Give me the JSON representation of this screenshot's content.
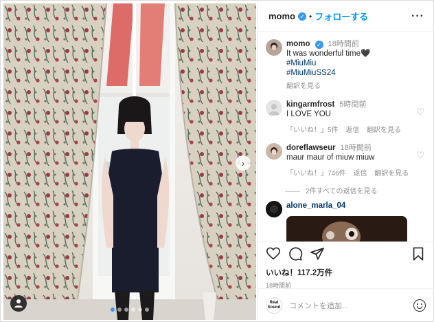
{
  "header": {
    "username": "momo",
    "separator": "•",
    "follow_label": "フォローする",
    "more_label": "···"
  },
  "caption": {
    "username": "momo",
    "time": "18時間前",
    "text": "It was wonderful time🖤",
    "hashtags": [
      "#MiuMiu",
      "#MiuMiuSS24"
    ],
    "translate_label": "翻訳を見る"
  },
  "comments": [
    {
      "username": "kingarmfrost",
      "time": "5時間前",
      "text": "I LOVE YOU",
      "likes_label": "「いいね！」5件",
      "reply_label": "返信",
      "translate_label": "翻訳を見る"
    },
    {
      "username": "doreflawseur",
      "time": "18時間前",
      "text": "maur maur of miuw miuw",
      "likes_label": "「いいね！」746件",
      "reply_label": "返信",
      "translate_label": "翻訳を見る",
      "view_replies_label": "2件すべての返信を見る"
    },
    {
      "username": "alone_marla_04"
    }
  ],
  "actions": {
    "likes_label": "いいね！117.2万件",
    "posted_time": "18時間前"
  },
  "comment_box": {
    "avatar_text": "Real Sound",
    "placeholder": "コメントを追加..."
  },
  "carousel": {
    "slide_count": 6,
    "active_index": 0
  },
  "colors": {
    "accent": "#0095f6",
    "hashtag": "#00376b",
    "muted": "#8e8e8e"
  },
  "icons": [
    "heart-icon",
    "comment-icon",
    "share-icon",
    "bookmark-icon",
    "verified-badge-icon",
    "emoji-icon",
    "tag-people-icon",
    "chevron-right-icon"
  ]
}
